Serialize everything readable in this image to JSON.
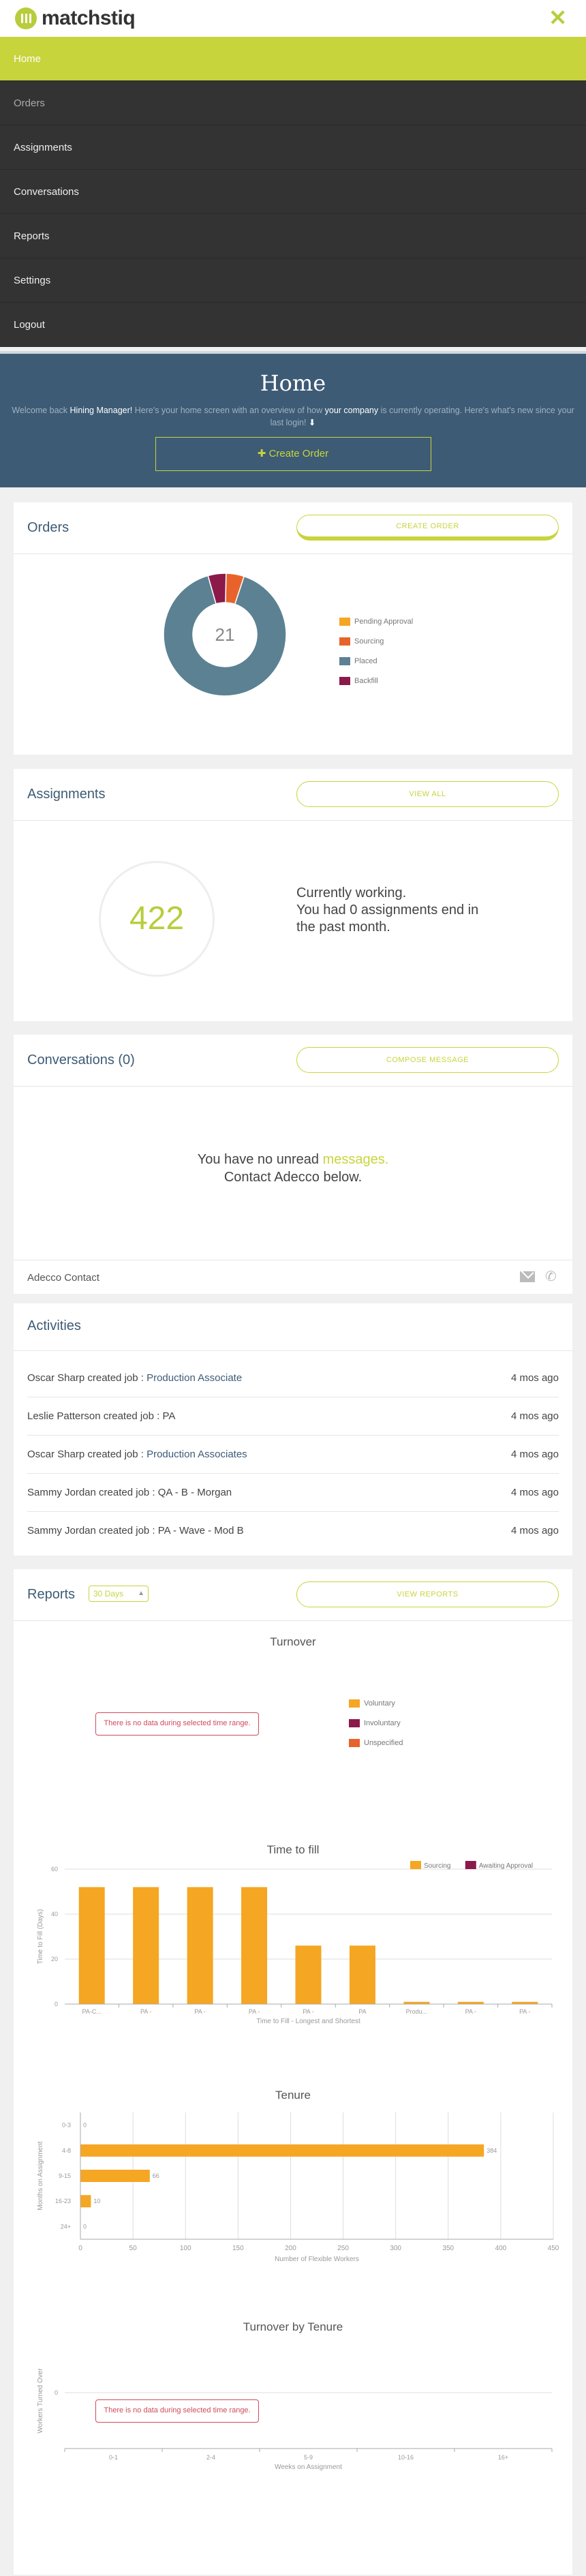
{
  "header": {
    "logo_text": "matchstiq",
    "close_icon": "close-icon",
    "accent": "#c8d43c"
  },
  "nav": [
    {
      "label": "Home"
    },
    {
      "label": "Orders"
    },
    {
      "label": "Assignments"
    },
    {
      "label": "Conversations"
    },
    {
      "label": "Reports"
    },
    {
      "label": "Settings"
    },
    {
      "label": "Logout"
    }
  ],
  "hero": {
    "title": "Home",
    "welcome_prefix": "Welcome back ",
    "user_role": "Hining Manager!",
    "welcome_mid": " Here's your home screen with an overview of how ",
    "company": "your company",
    "welcome_suffix": " is currently operating. Here's what's new since your last login!",
    "create_order": "✚ Create Order"
  },
  "orders": {
    "title": "Orders",
    "button": "CREATE ORDER",
    "total": "21",
    "legend": [
      {
        "label": "Pending Approval",
        "color": "#f5a623"
      },
      {
        "label": "Sourcing",
        "color": "#e8632b"
      },
      {
        "label": "Placed",
        "color": "#5b8193"
      },
      {
        "label": "Backfill",
        "color": "#8b1a4a"
      }
    ]
  },
  "assignments": {
    "title": "Assignments",
    "button": "VIEW ALL",
    "count": "422",
    "line1": "Currently working.",
    "line2": "You had 0 assignments end in the past month."
  },
  "conversations": {
    "title": "Conversations (0)",
    "button": "COMPOSE MESSAGE",
    "msg_prefix": "You have no unread ",
    "msg_link": "messages.",
    "msg_line2": "Contact Adecco below.",
    "contact_label": "Adecco Contact"
  },
  "activities": {
    "title": "Activities",
    "rows": [
      {
        "text": "Oscar Sharp created job : ",
        "link": "Production Associate",
        "when": "4 mos ago"
      },
      {
        "text": "Leslie Patterson created job : PA",
        "link": "",
        "when": "4 mos ago"
      },
      {
        "text": "Oscar Sharp created job : ",
        "link": "Production Associates",
        "when": "4 mos ago"
      },
      {
        "text": "Sammy Jordan created job : QA - B - Morgan",
        "link": "",
        "when": "4 mos ago"
      },
      {
        "text": "Sammy Jordan created job : PA - Wave - Mod B",
        "link": "",
        "when": "4 mos ago"
      }
    ]
  },
  "reports": {
    "title": "Reports",
    "range": "30 Days",
    "button": "VIEW REPORTS",
    "no_data": "There is no data during selected time range."
  },
  "chart_data": [
    {
      "type": "pie",
      "title": "",
      "labels": [
        "Pending Approval",
        "Sourcing",
        "Placed",
        "Backfill"
      ],
      "values": [
        0,
        1,
        19,
        1
      ]
    },
    {
      "type": "pie",
      "title": "Turnover",
      "labels": [
        "Voluntary",
        "Involuntary",
        "Unspecified"
      ],
      "values": [],
      "colors": [
        "#f5a623",
        "#8b1a4a",
        "#e8632b"
      ]
    },
    {
      "type": "bar",
      "title": "Time to fill",
      "categories": [
        "PA-C...",
        "PA -",
        "PA -",
        "PA -",
        "PA -",
        "PA",
        "Produ...",
        "PA -",
        "PA -"
      ],
      "series": [
        {
          "name": "Sourcing",
          "values": [
            52,
            52,
            52,
            52,
            26,
            26,
            1,
            1,
            1
          ],
          "color": "#f5a623"
        },
        {
          "name": "Awaiting Approval",
          "values": [
            0,
            0,
            0,
            0,
            0,
            0,
            0,
            0,
            0
          ],
          "color": "#8b1a4a"
        }
      ],
      "xlabel": "Time to Fill - Longest and Shortest",
      "ylabel": "Time to Fill (Days)",
      "ylim": [
        0,
        60
      ],
      "yticks": [
        0,
        20,
        40,
        60
      ]
    },
    {
      "type": "bar",
      "orientation": "horizontal",
      "title": "Tenure",
      "categories": [
        "0-3",
        "4-8",
        "9-15",
        "16-23",
        "24+"
      ],
      "values": [
        0,
        384,
        66,
        10,
        0
      ],
      "value_labels": [
        "0",
        "384",
        "66",
        "10",
        "0"
      ],
      "xlabel": "Number of Flexible Workers",
      "ylabel": "Months on Assignment",
      "xlim": [
        0,
        450
      ],
      "xticks": [
        0,
        50,
        100,
        150,
        200,
        250,
        300,
        350,
        400,
        450
      ],
      "color": "#f5a623"
    },
    {
      "type": "line",
      "title": "Turnover by Tenure",
      "categories": [
        "0-1",
        "2-4",
        "5-9",
        "10-16",
        "16+"
      ],
      "values": [],
      "xlabel": "Weeks on Assignment",
      "ylabel": "Workers Turned Over",
      "yticks": [
        0
      ]
    }
  ]
}
